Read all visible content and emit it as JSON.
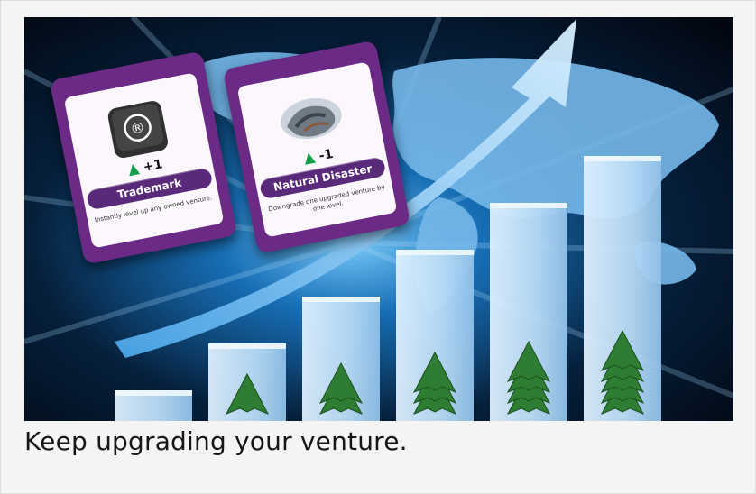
{
  "caption": "Keep upgrading your venture.",
  "cards": [
    {
      "title": "Trademark Registered",
      "cost_symbol": "+1",
      "description": "Instantly level up any owned venture.",
      "image_icon": "registered-trademark-key-icon",
      "registered_symbol": "®"
    },
    {
      "title": "Natural Disaster",
      "cost_symbol": "-1",
      "description": "Downgrade one upgraded venture by one level.",
      "image_icon": "storm-tornado-icon"
    }
  ],
  "chart_data": {
    "type": "bar",
    "categories": [
      "1",
      "2",
      "3",
      "4",
      "5",
      "6"
    ],
    "values": [
      1,
      2,
      3,
      4,
      5,
      6
    ]
  },
  "colors": {
    "card_purple": "#6a2a86",
    "bar_light_blue": "#cfe6fb",
    "tree_green": "#2e7d32",
    "background_dark": "#02060f"
  }
}
